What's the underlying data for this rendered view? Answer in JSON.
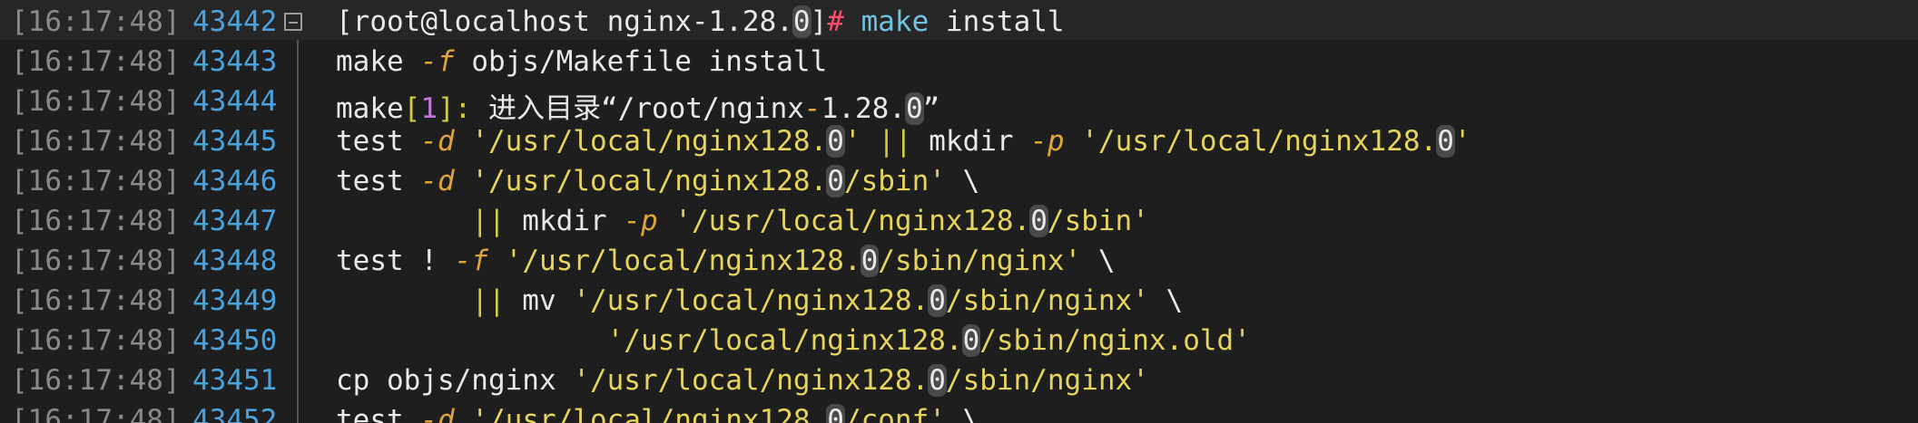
{
  "rows": [
    {
      "timestamp": "[16:17:48]",
      "line": "43442",
      "segments": [
        {
          "text": "[root@localhost nginx-1.28.",
          "style": "plain"
        },
        {
          "text": "0",
          "style": "digit0"
        },
        {
          "text": "]",
          "style": "plain"
        },
        {
          "text": "#",
          "style": "prompt-hash"
        },
        {
          "text": " ",
          "style": "plain"
        },
        {
          "text": "make",
          "style": "cmd"
        },
        {
          "text": " install",
          "style": "plain"
        }
      ]
    },
    {
      "timestamp": "[16:17:48]",
      "line": "43443",
      "segments": [
        {
          "text": "make ",
          "style": "plain"
        },
        {
          "text": "-f",
          "style": "flag"
        },
        {
          "text": " objs/Makefile install",
          "style": "plain"
        }
      ]
    },
    {
      "timestamp": "[16:17:48]",
      "line": "43444",
      "segments": [
        {
          "text": "make",
          "style": "plain"
        },
        {
          "text": "[",
          "style": "op"
        },
        {
          "text": "1",
          "style": "num"
        },
        {
          "text": "]",
          "style": "op"
        },
        {
          "text": ": ",
          "style": "op"
        },
        {
          "text": "进入目录“/root/nginx",
          "style": "plain"
        },
        {
          "text": "-",
          "style": "flag"
        },
        {
          "text": "1.28.",
          "style": "plain"
        },
        {
          "text": "0",
          "style": "digit0"
        },
        {
          "text": "”",
          "style": "plain"
        }
      ]
    },
    {
      "timestamp": "[16:17:48]",
      "line": "43445",
      "segments": [
        {
          "text": "test ",
          "style": "plain"
        },
        {
          "text": "-d",
          "style": "flag"
        },
        {
          "text": " ",
          "style": "plain"
        },
        {
          "text": "'/usr/local/nginx128.",
          "style": "str"
        },
        {
          "text": "0",
          "style": "digit0"
        },
        {
          "text": "'",
          "style": "str"
        },
        {
          "text": " ",
          "style": "plain"
        },
        {
          "text": "||",
          "style": "op"
        },
        {
          "text": " mkdir ",
          "style": "plain"
        },
        {
          "text": "-p",
          "style": "flag"
        },
        {
          "text": " ",
          "style": "plain"
        },
        {
          "text": "'/usr/local/nginx128.",
          "style": "str"
        },
        {
          "text": "0",
          "style": "digit0"
        },
        {
          "text": "'",
          "style": "str"
        }
      ]
    },
    {
      "timestamp": "[16:17:48]",
      "line": "43446",
      "segments": [
        {
          "text": "test ",
          "style": "plain"
        },
        {
          "text": "-d",
          "style": "flag"
        },
        {
          "text": " ",
          "style": "plain"
        },
        {
          "text": "'/usr/local/nginx128.",
          "style": "str"
        },
        {
          "text": "0",
          "style": "digit0"
        },
        {
          "text": "/sbin'",
          "style": "str"
        },
        {
          "text": " \\",
          "style": "plain"
        }
      ]
    },
    {
      "timestamp": "[16:17:48]",
      "line": "43447",
      "segments": [
        {
          "text": "        ",
          "style": "plain"
        },
        {
          "text": "||",
          "style": "op"
        },
        {
          "text": " mkdir ",
          "style": "plain"
        },
        {
          "text": "-p",
          "style": "flag"
        },
        {
          "text": " ",
          "style": "plain"
        },
        {
          "text": "'/usr/local/nginx128.",
          "style": "str"
        },
        {
          "text": "0",
          "style": "digit0"
        },
        {
          "text": "/sbin'",
          "style": "str"
        }
      ]
    },
    {
      "timestamp": "[16:17:48]",
      "line": "43448",
      "segments": [
        {
          "text": "test ",
          "style": "plain"
        },
        {
          "text": "!",
          "style": "bang"
        },
        {
          "text": " ",
          "style": "plain"
        },
        {
          "text": "-f",
          "style": "flag"
        },
        {
          "text": " ",
          "style": "plain"
        },
        {
          "text": "'/usr/local/nginx128.",
          "style": "str"
        },
        {
          "text": "0",
          "style": "digit0"
        },
        {
          "text": "/sbin/nginx'",
          "style": "str"
        },
        {
          "text": " \\",
          "style": "plain"
        }
      ]
    },
    {
      "timestamp": "[16:17:48]",
      "line": "43449",
      "segments": [
        {
          "text": "        ",
          "style": "plain"
        },
        {
          "text": "||",
          "style": "op"
        },
        {
          "text": " mv ",
          "style": "plain"
        },
        {
          "text": "'/usr/local/nginx128.",
          "style": "str"
        },
        {
          "text": "0",
          "style": "digit0"
        },
        {
          "text": "/sbin/nginx'",
          "style": "str"
        },
        {
          "text": " \\",
          "style": "plain"
        }
      ]
    },
    {
      "timestamp": "[16:17:48]",
      "line": "43450",
      "segments": [
        {
          "text": "                ",
          "style": "plain"
        },
        {
          "text": "'/usr/local/nginx128.",
          "style": "str"
        },
        {
          "text": "0",
          "style": "digit0"
        },
        {
          "text": "/sbin/nginx.old'",
          "style": "str"
        }
      ]
    },
    {
      "timestamp": "[16:17:48]",
      "line": "43451",
      "segments": [
        {
          "text": "cp objs/nginx ",
          "style": "plain"
        },
        {
          "text": "'/usr/local/nginx128.",
          "style": "str"
        },
        {
          "text": "0",
          "style": "digit0"
        },
        {
          "text": "/sbin/nginx'",
          "style": "str"
        }
      ]
    },
    {
      "timestamp": "[16:17:48]",
      "line": "43452",
      "segments": [
        {
          "text": "test ",
          "style": "plain"
        },
        {
          "text": "-d",
          "style": "flag"
        },
        {
          "text": " ",
          "style": "plain"
        },
        {
          "text": "'/usr/local/nginx128.",
          "style": "str"
        },
        {
          "text": "0",
          "style": "digit0"
        },
        {
          "text": "/conf'",
          "style": "str"
        },
        {
          "text": " \\",
          "style": "plain"
        }
      ]
    }
  ]
}
